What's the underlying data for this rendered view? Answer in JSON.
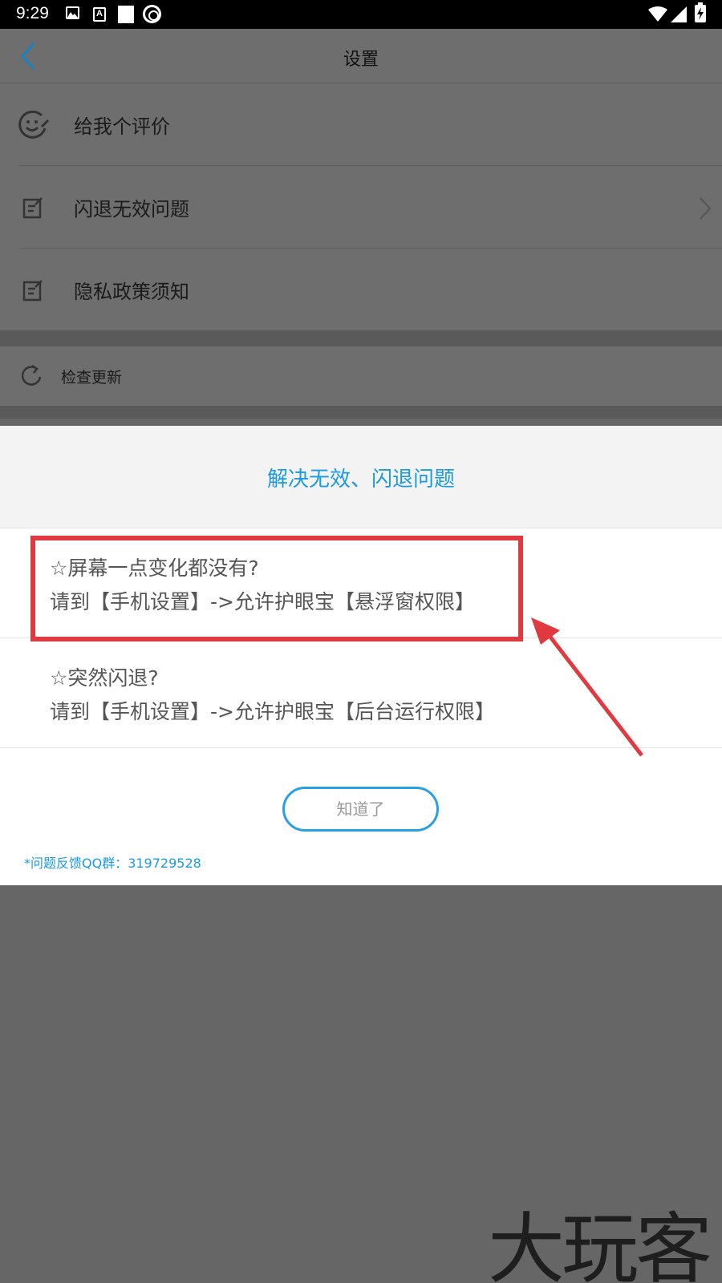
{
  "status_bar": {
    "time": "9:29",
    "icons": [
      "image-icon",
      "text-a-icon",
      "square-icon",
      "sync-circle-icon",
      "wifi-icon",
      "signal-icon",
      "battery-charging-icon"
    ]
  },
  "navbar": {
    "title": "设置",
    "back_icon": "chevron-left-icon"
  },
  "settings": {
    "items": [
      {
        "label": "给我个评价",
        "icon": "smiley-icon"
      },
      {
        "label": "闪退无效问题",
        "icon": "edit-note-icon",
        "chevron": true
      },
      {
        "label": "隐私政策须知",
        "icon": "edit-note-icon"
      }
    ],
    "update": {
      "label": "检查更新",
      "icon": "refresh-icon"
    }
  },
  "dialog": {
    "title": "解决无效、闪退问题",
    "tips": [
      {
        "question": "☆屏幕一点变化都没有?",
        "answer": "请到【手机设置】->允许护眼宝【悬浮窗权限】"
      },
      {
        "question": "☆突然闪退?",
        "answer": "请到【手机设置】->允许护眼宝【后台运行权限】"
      }
    ],
    "ok_label": "知道了",
    "feedback": "*问题反馈QQ群：319729528"
  },
  "annotation": {
    "highlight_color": "#e03a40",
    "arrow_color": "#e03a40"
  },
  "watermark": "大玩客",
  "colors": {
    "accent": "#1a9ae0",
    "overlay": "#666666",
    "text": "#555555"
  }
}
